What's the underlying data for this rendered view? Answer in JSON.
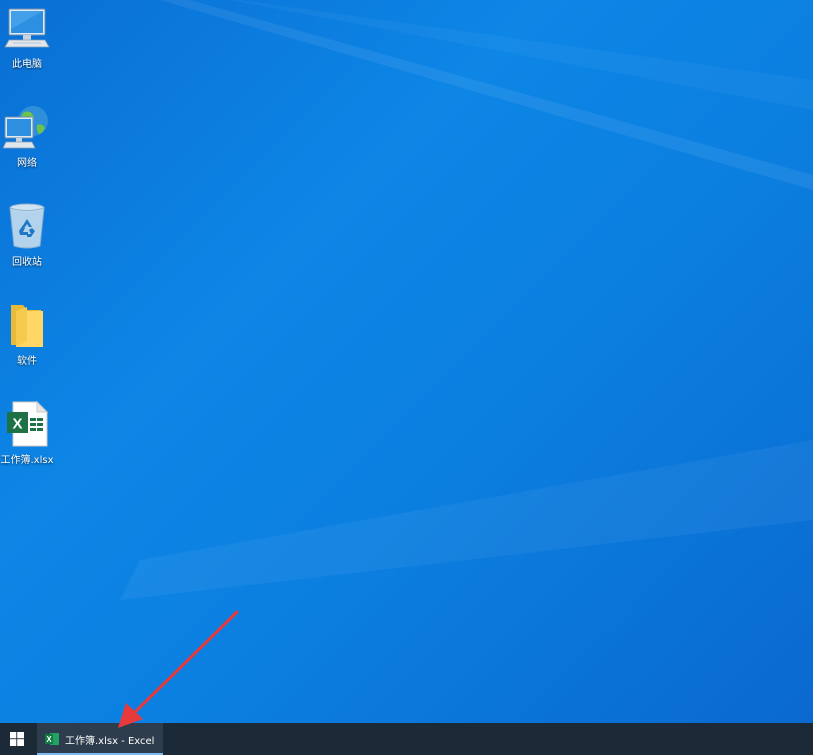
{
  "desktop": {
    "icons": [
      {
        "label": "此电脑",
        "icon": "computer-icon"
      },
      {
        "label": "网络",
        "icon": "network-icon"
      },
      {
        "label": "回收站",
        "icon": "recycle-bin-icon"
      },
      {
        "label": "软件",
        "icon": "folder-icon"
      },
      {
        "label": "工作簿.xlsx",
        "icon": "excel-file-icon"
      }
    ]
  },
  "taskbar": {
    "start_icon": "windows-logo-icon",
    "items": [
      {
        "label": "工作簿.xlsx - Excel",
        "icon": "excel-app-icon",
        "active": true
      }
    ]
  },
  "colors": {
    "desktop_blue": "#0b7fe0",
    "taskbar": "#1c2a38",
    "excel_green": "#1e7145",
    "annotation_arrow": "#e8393b"
  }
}
